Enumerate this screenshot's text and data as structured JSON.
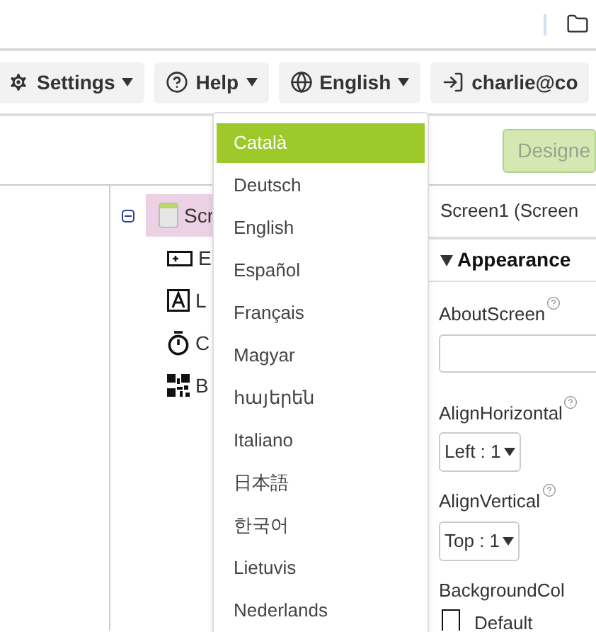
{
  "toolbar": {
    "buttons": [
      {
        "kind": "settings",
        "label": "Settings"
      },
      {
        "kind": "help",
        "label": "Help"
      },
      {
        "kind": "language",
        "label": "English"
      },
      {
        "kind": "account",
        "label": "charlie@co"
      }
    ]
  },
  "language_menu": {
    "items": [
      {
        "label": "Català",
        "selected": true
      },
      {
        "label": "Deutsch",
        "selected": false
      },
      {
        "label": "English",
        "selected": false
      },
      {
        "label": "Español",
        "selected": false
      },
      {
        "label": "Français",
        "selected": false
      },
      {
        "label": "Magyar",
        "selected": false
      },
      {
        "label": "հայերեն",
        "selected": false
      },
      {
        "label": "Italiano",
        "selected": false
      },
      {
        "label": "日本語",
        "selected": false
      },
      {
        "label": "한국어",
        "selected": false
      },
      {
        "label": "Lietuvis",
        "selected": false
      },
      {
        "label": "Nederlands",
        "selected": false
      }
    ]
  },
  "designer_button": {
    "label": "Designe"
  },
  "tree": {
    "items": [
      {
        "kind": "screen",
        "label": "Scr",
        "selected": true,
        "expanded": true,
        "children": [
          {
            "kind": "button",
            "label": "E"
          },
          {
            "kind": "label",
            "label": "L"
          },
          {
            "kind": "clock",
            "label": "C"
          },
          {
            "kind": "barcode",
            "label": "B"
          }
        ]
      }
    ]
  },
  "properties": {
    "header": "Screen1 (Screen",
    "section": {
      "label": "Appearance",
      "expanded": true
    },
    "fields": [
      {
        "kind": "text",
        "label": "AboutScreen",
        "help": true
      },
      {
        "kind": "select",
        "label": "AlignHorizontal",
        "help": true,
        "value": "Left : 1"
      },
      {
        "kind": "select",
        "label": "AlignVertical",
        "help": true,
        "value": "Top : 1"
      },
      {
        "kind": "color",
        "label": "BackgroundCol",
        "value": "Default"
      }
    ]
  }
}
